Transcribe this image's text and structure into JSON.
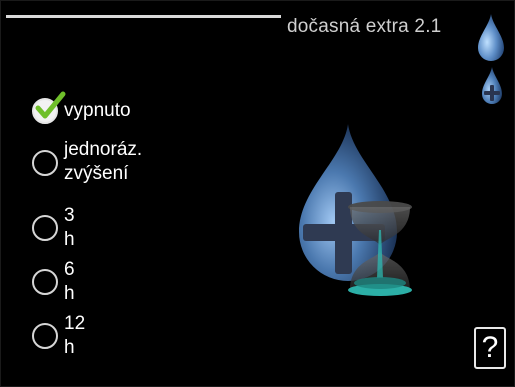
{
  "header": {
    "title": "dočasná extra 2.1"
  },
  "icons": {
    "menu_drop_1": "water-drop-icon",
    "menu_drop_2": "water-drop-plus-icon",
    "illustration": "hot-water-timer-illustration",
    "help": "help-icon"
  },
  "options": [
    {
      "label": "vypnuto",
      "selected": true
    },
    {
      "label_line1": "jednoráz.",
      "label_line2": "zvýšení",
      "selected": false
    },
    {
      "label": "3 h",
      "selected": false
    },
    {
      "label": "6 h",
      "selected": false
    },
    {
      "label": "12 h",
      "selected": false
    }
  ],
  "help": {
    "label": "?"
  },
  "colors": {
    "background": "#000000",
    "drop_blue": "#5f8fc8",
    "accent_teal": "#2fb9b0",
    "check_green": "#6fbf2a"
  }
}
